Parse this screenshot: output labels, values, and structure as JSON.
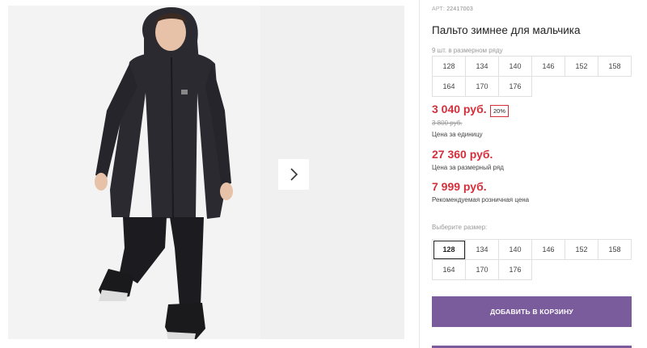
{
  "product": {
    "article_label": "АРТ:",
    "article_number": "22417003",
    "title": "Пальто зимнее для мальчика",
    "row_note": "9 шт. в размерном ряду"
  },
  "size_row": [
    "128",
    "134",
    "140",
    "146",
    "152",
    "158",
    "164",
    "170",
    "176"
  ],
  "prices": {
    "unit_price": "3 040 руб.",
    "discount_badge": "20%",
    "old_price": "3 800 руб.",
    "unit_caption": "Цена за единицу",
    "row_price": "27 360 руб.",
    "row_caption": "Цена за размерный ряд",
    "retail_price": "7 999 руб.",
    "retail_caption": "Рекомендуемая розничная цена"
  },
  "size_select": {
    "label": "Выберите размер:",
    "selected": "128",
    "options": [
      "128",
      "134",
      "140",
      "146",
      "152",
      "158",
      "164",
      "170",
      "176"
    ]
  },
  "cart": {
    "button_label": "ДОБАВИТЬ В КОРЗИНУ"
  },
  "icons": {
    "next": "chevron-right-icon"
  },
  "colors": {
    "price_red": "#d3303c",
    "accent_purple": "#7a5c9c"
  }
}
